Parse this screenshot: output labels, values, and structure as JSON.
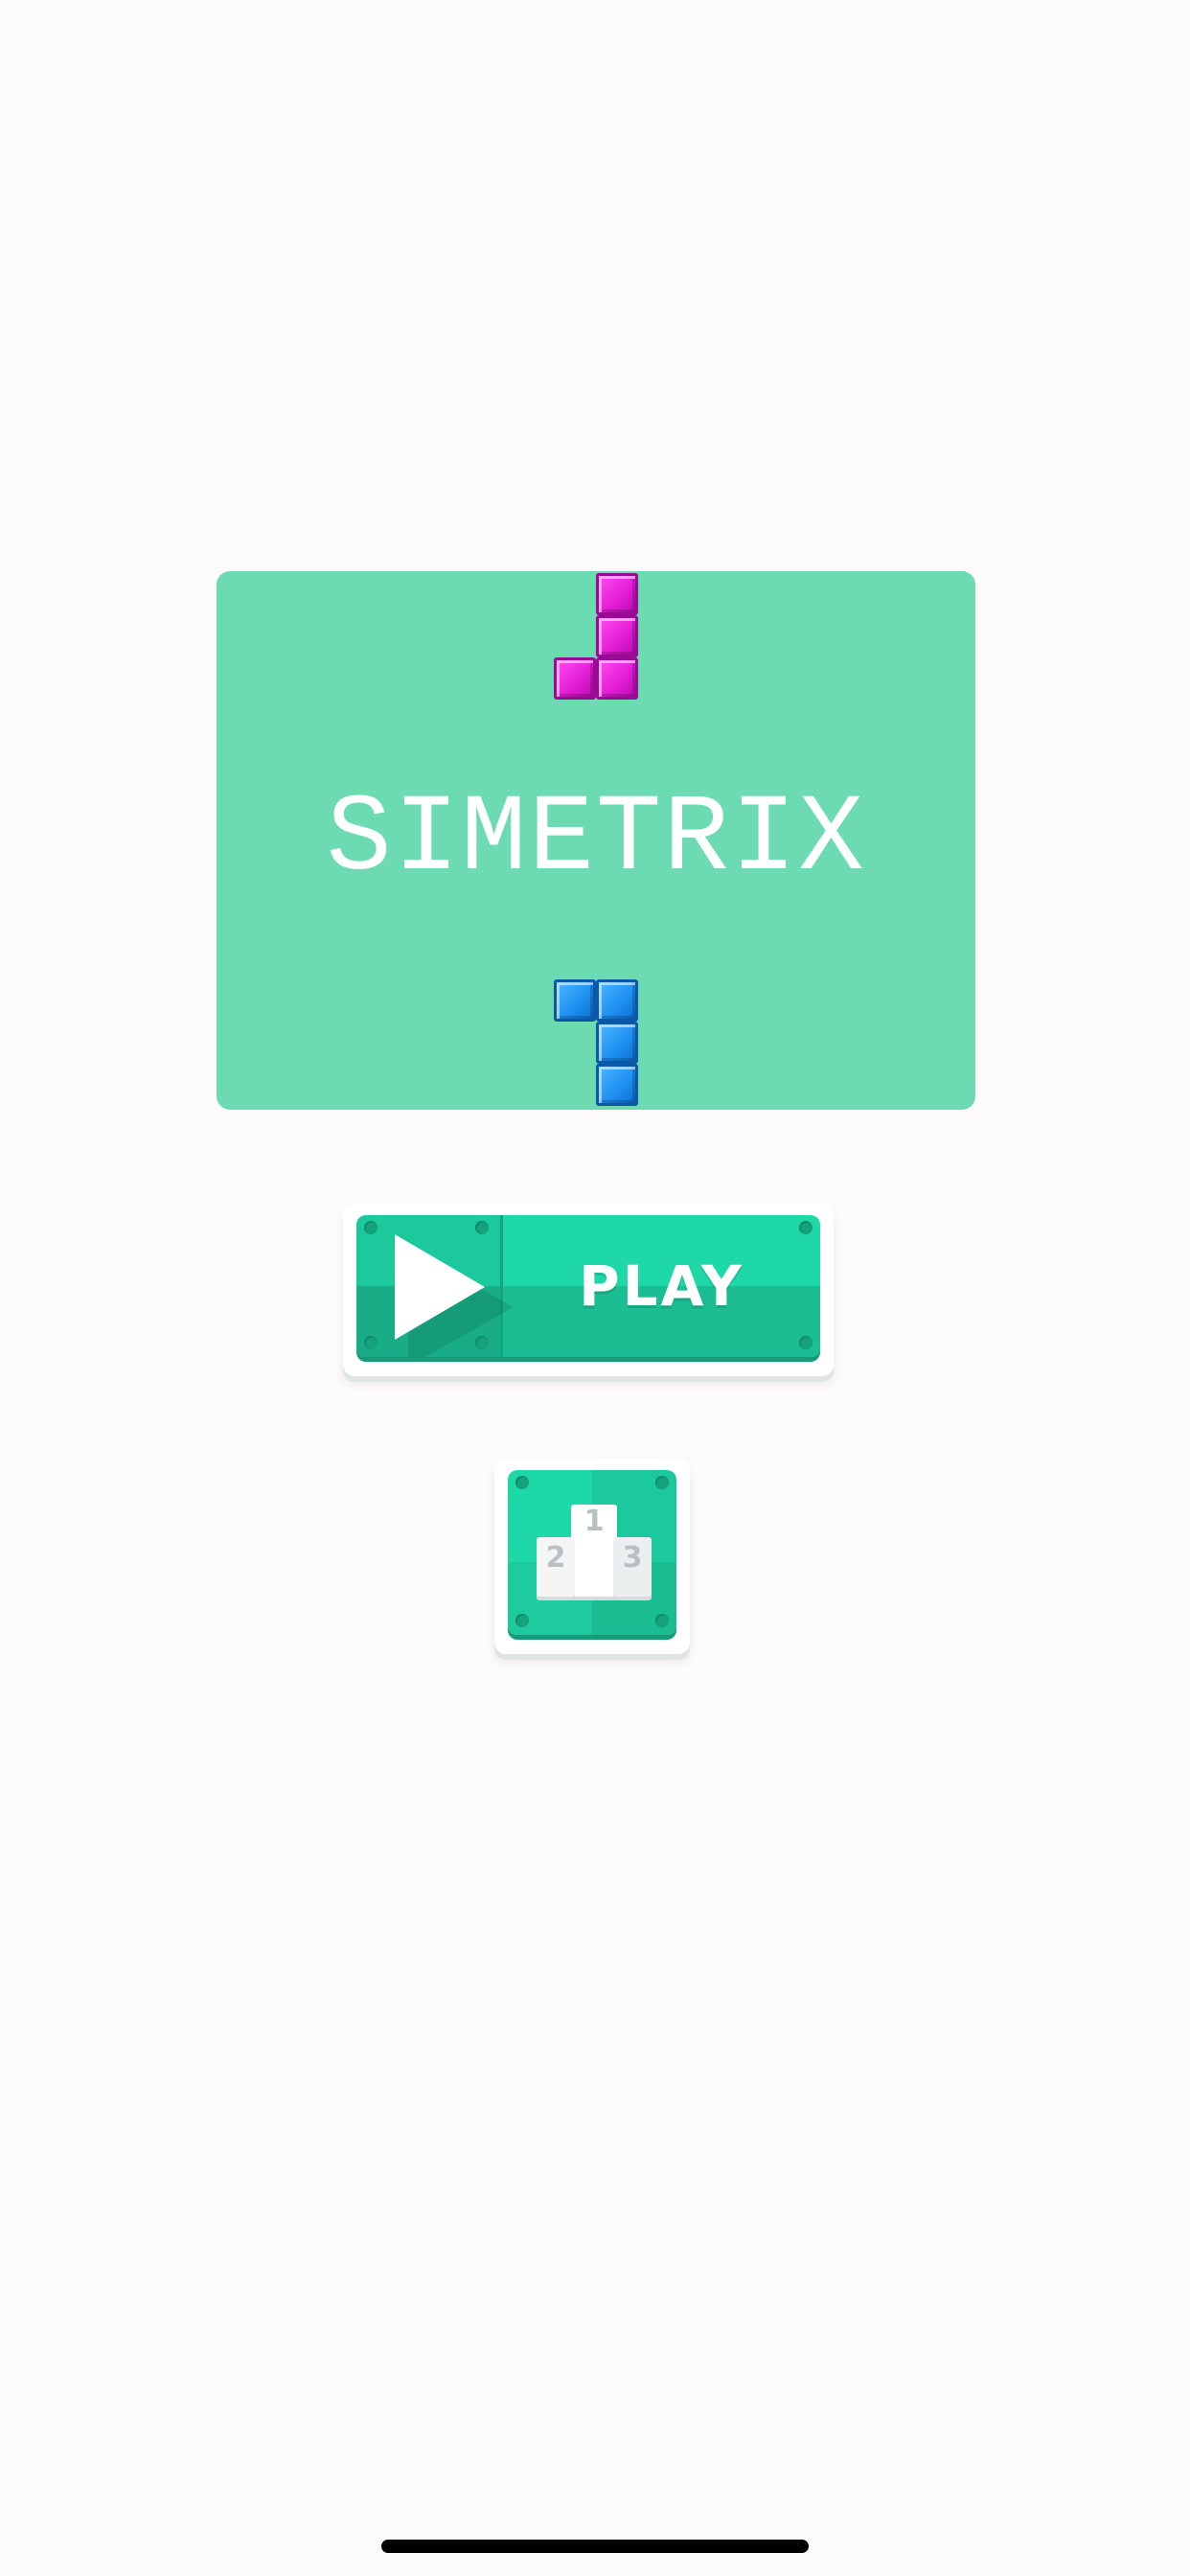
{
  "game": {
    "title": "SIMETRIX"
  },
  "menu": {
    "play_label": "PLAY",
    "play_icon": "play-triangle-icon",
    "leaderboard_icon": "podium-icon",
    "podium_places": [
      "1",
      "2",
      "3"
    ]
  },
  "colors": {
    "background": "#fdfbf9",
    "title_card": "#6cdbb1",
    "button_face": "#1fd8a8",
    "block_top": "#e21cd4",
    "block_bottom": "#1d8ff0"
  }
}
